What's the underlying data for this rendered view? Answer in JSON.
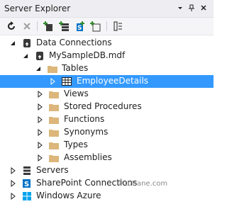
{
  "window": {
    "title": "Server Explorer"
  },
  "title_buttons": {
    "dropdown_icon": "dropdown-arrow-icon",
    "pin_icon": "pin-icon",
    "close_icon": "close-icon"
  },
  "toolbar": {
    "icons": [
      "refresh-icon",
      "stop-icon",
      "connect-to-database-icon",
      "connect-to-server-icon",
      "connect-to-sharepoint-icon",
      "connect-to-azure-icon",
      "properties-icon"
    ]
  },
  "tree": {
    "data_connections": "Data Connections",
    "database": "MySampleDB.mdf",
    "tables": "Tables",
    "employee_details": "EmployeeDetails",
    "views": "Views",
    "stored_procedures": "Stored Procedures",
    "functions": "Functions",
    "synonyms": "Synonyms",
    "types": "Types",
    "assemblies": "Assemblies",
    "servers": "Servers",
    "sharepoint": "SharePoint Connections",
    "azure": "Windows Azure"
  },
  "watermark": {
    "symbol": "©",
    "text": "tutlane.com"
  },
  "colors": {
    "selection": "#3399ff",
    "folder": "#dcb67a",
    "titlebar": "#eeeef2",
    "azure": "#00a2ed"
  }
}
